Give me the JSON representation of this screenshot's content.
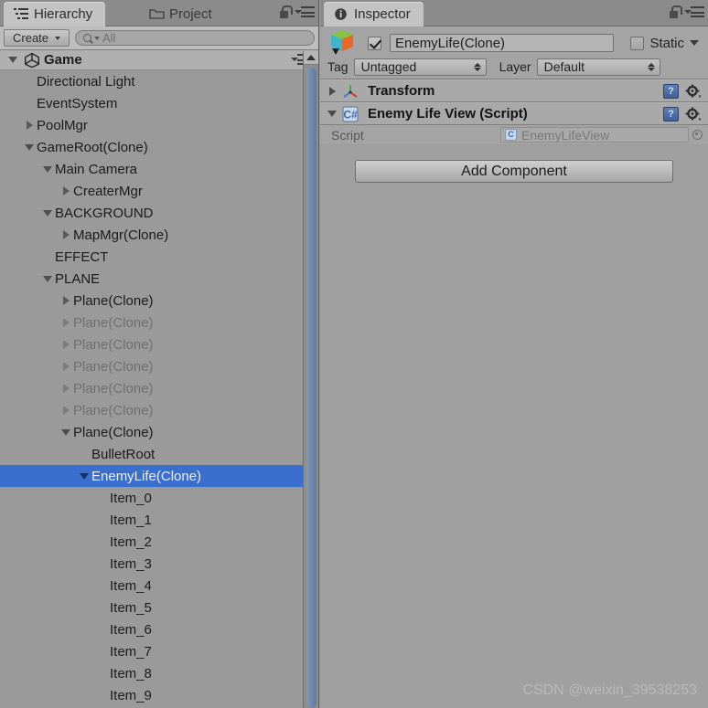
{
  "hierarchy": {
    "tabs": [
      {
        "label": "Hierarchy",
        "icon": "hierarchy-icon",
        "active": true
      },
      {
        "label": "Project",
        "icon": "folder-icon",
        "active": false
      }
    ],
    "toolbar": {
      "create_label": "Create",
      "search_placeholder": "All",
      "search_value": "All",
      "search_icon": "search-icon"
    },
    "root": {
      "label": "Game",
      "icon": "unity-logo-icon",
      "expanded": true
    },
    "items": [
      {
        "label": "Directional Light",
        "indent": 1,
        "twisty": "none",
        "faded": false,
        "selected": false
      },
      {
        "label": "EventSystem",
        "indent": 1,
        "twisty": "none",
        "faded": false,
        "selected": false
      },
      {
        "label": "PoolMgr",
        "indent": 1,
        "twisty": "collapsed",
        "faded": false,
        "selected": false
      },
      {
        "label": "GameRoot(Clone)",
        "indent": 1,
        "twisty": "expanded",
        "faded": false,
        "selected": false
      },
      {
        "label": "Main Camera",
        "indent": 2,
        "twisty": "expanded",
        "faded": false,
        "selected": false
      },
      {
        "label": "CreaterMgr",
        "indent": 3,
        "twisty": "collapsed",
        "faded": false,
        "selected": false
      },
      {
        "label": "BACKGROUND",
        "indent": 2,
        "twisty": "expanded",
        "faded": false,
        "selected": false
      },
      {
        "label": "MapMgr(Clone)",
        "indent": 3,
        "twisty": "collapsed",
        "faded": false,
        "selected": false
      },
      {
        "label": "EFFECT",
        "indent": 2,
        "twisty": "none",
        "faded": false,
        "selected": false
      },
      {
        "label": "PLANE",
        "indent": 2,
        "twisty": "expanded",
        "faded": false,
        "selected": false
      },
      {
        "label": "Plane(Clone)",
        "indent": 3,
        "twisty": "collapsed",
        "faded": false,
        "selected": false
      },
      {
        "label": "Plane(Clone)",
        "indent": 3,
        "twisty": "collapsed",
        "faded": true,
        "selected": false
      },
      {
        "label": "Plane(Clone)",
        "indent": 3,
        "twisty": "collapsed",
        "faded": true,
        "selected": false
      },
      {
        "label": "Plane(Clone)",
        "indent": 3,
        "twisty": "collapsed",
        "faded": true,
        "selected": false
      },
      {
        "label": "Plane(Clone)",
        "indent": 3,
        "twisty": "collapsed",
        "faded": true,
        "selected": false
      },
      {
        "label": "Plane(Clone)",
        "indent": 3,
        "twisty": "collapsed",
        "faded": true,
        "selected": false
      },
      {
        "label": "Plane(Clone)",
        "indent": 3,
        "twisty": "expanded",
        "faded": false,
        "selected": false
      },
      {
        "label": "BulletRoot",
        "indent": 4,
        "twisty": "none",
        "faded": false,
        "selected": false
      },
      {
        "label": "EnemyLife(Clone)",
        "indent": 4,
        "twisty": "expanded",
        "faded": false,
        "selected": true
      },
      {
        "label": "Item_0",
        "indent": 5,
        "twisty": "none",
        "faded": false,
        "selected": false
      },
      {
        "label": "Item_1",
        "indent": 5,
        "twisty": "none",
        "faded": false,
        "selected": false
      },
      {
        "label": "Item_2",
        "indent": 5,
        "twisty": "none",
        "faded": false,
        "selected": false
      },
      {
        "label": "Item_3",
        "indent": 5,
        "twisty": "none",
        "faded": false,
        "selected": false
      },
      {
        "label": "Item_4",
        "indent": 5,
        "twisty": "none",
        "faded": false,
        "selected": false
      },
      {
        "label": "Item_5",
        "indent": 5,
        "twisty": "none",
        "faded": false,
        "selected": false
      },
      {
        "label": "Item_6",
        "indent": 5,
        "twisty": "none",
        "faded": false,
        "selected": false
      },
      {
        "label": "Item_7",
        "indent": 5,
        "twisty": "none",
        "faded": false,
        "selected": false
      },
      {
        "label": "Item_8",
        "indent": 5,
        "twisty": "none",
        "faded": false,
        "selected": false
      },
      {
        "label": "Item_9",
        "indent": 5,
        "twisty": "none",
        "faded": false,
        "selected": false
      }
    ]
  },
  "inspector": {
    "tab": {
      "label": "Inspector",
      "icon": "info-icon"
    },
    "object": {
      "icon": "gameobject-cube-icon",
      "enabled": true,
      "name": "EnemyLife(Clone)",
      "static_label": "Static",
      "static_checked": false,
      "tag_label": "Tag",
      "tag_value": "Untagged",
      "layer_label": "Layer",
      "layer_value": "Default"
    },
    "components": [
      {
        "title": "Transform",
        "icon": "transform-axis-icon",
        "expanded": false,
        "help_icon": "help-book-icon",
        "gear_icon": "gear-icon",
        "properties": []
      },
      {
        "title": "Enemy Life View (Script)",
        "icon": "csharp-script-icon",
        "expanded": true,
        "help_icon": "help-book-icon",
        "gear_icon": "gear-icon",
        "properties": [
          {
            "label": "Script",
            "value": "EnemyLifeView",
            "badge": "#",
            "picker_icon": "object-picker-icon"
          }
        ]
      }
    ],
    "add_component_label": "Add Component"
  },
  "chrome": {
    "lock_icon": "lock-icon",
    "menu_icon": "panel-menu-icon"
  },
  "watermark": "CSDN @weixin_39538253",
  "colors": {
    "selection": "#3a6fd0",
    "panel_bg": "#9a9a9a",
    "inspector_bg": "#a0a0a0",
    "scrollbar_thumb": "#7289ac"
  }
}
